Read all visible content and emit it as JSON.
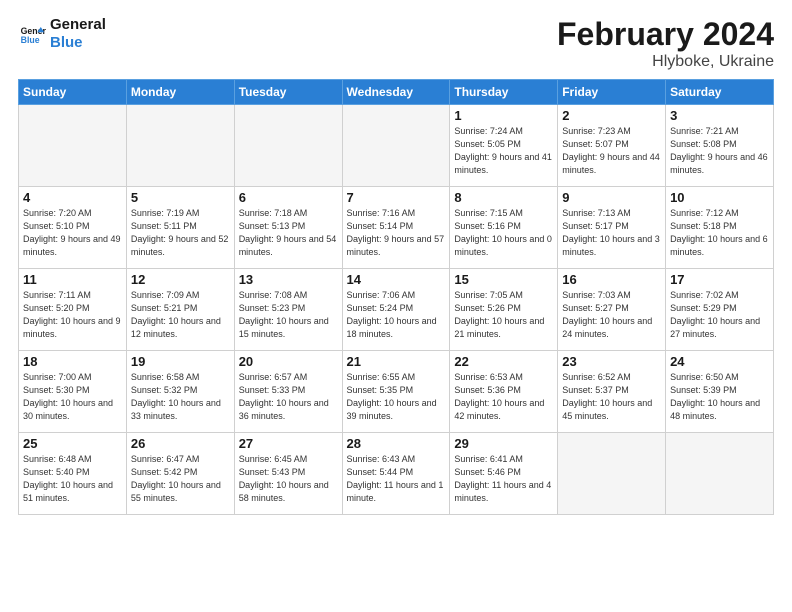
{
  "header": {
    "logo_line1": "General",
    "logo_line2": "Blue",
    "main_title": "February 2024",
    "sub_title": "Hlyboke, Ukraine"
  },
  "days_of_week": [
    "Sunday",
    "Monday",
    "Tuesday",
    "Wednesday",
    "Thursday",
    "Friday",
    "Saturday"
  ],
  "weeks": [
    [
      {
        "day": "",
        "info": ""
      },
      {
        "day": "",
        "info": ""
      },
      {
        "day": "",
        "info": ""
      },
      {
        "day": "",
        "info": ""
      },
      {
        "day": "1",
        "info": "Sunrise: 7:24 AM\nSunset: 5:05 PM\nDaylight: 9 hours\nand 41 minutes."
      },
      {
        "day": "2",
        "info": "Sunrise: 7:23 AM\nSunset: 5:07 PM\nDaylight: 9 hours\nand 44 minutes."
      },
      {
        "day": "3",
        "info": "Sunrise: 7:21 AM\nSunset: 5:08 PM\nDaylight: 9 hours\nand 46 minutes."
      }
    ],
    [
      {
        "day": "4",
        "info": "Sunrise: 7:20 AM\nSunset: 5:10 PM\nDaylight: 9 hours\nand 49 minutes."
      },
      {
        "day": "5",
        "info": "Sunrise: 7:19 AM\nSunset: 5:11 PM\nDaylight: 9 hours\nand 52 minutes."
      },
      {
        "day": "6",
        "info": "Sunrise: 7:18 AM\nSunset: 5:13 PM\nDaylight: 9 hours\nand 54 minutes."
      },
      {
        "day": "7",
        "info": "Sunrise: 7:16 AM\nSunset: 5:14 PM\nDaylight: 9 hours\nand 57 minutes."
      },
      {
        "day": "8",
        "info": "Sunrise: 7:15 AM\nSunset: 5:16 PM\nDaylight: 10 hours\nand 0 minutes."
      },
      {
        "day": "9",
        "info": "Sunrise: 7:13 AM\nSunset: 5:17 PM\nDaylight: 10 hours\nand 3 minutes."
      },
      {
        "day": "10",
        "info": "Sunrise: 7:12 AM\nSunset: 5:18 PM\nDaylight: 10 hours\nand 6 minutes."
      }
    ],
    [
      {
        "day": "11",
        "info": "Sunrise: 7:11 AM\nSunset: 5:20 PM\nDaylight: 10 hours\nand 9 minutes."
      },
      {
        "day": "12",
        "info": "Sunrise: 7:09 AM\nSunset: 5:21 PM\nDaylight: 10 hours\nand 12 minutes."
      },
      {
        "day": "13",
        "info": "Sunrise: 7:08 AM\nSunset: 5:23 PM\nDaylight: 10 hours\nand 15 minutes."
      },
      {
        "day": "14",
        "info": "Sunrise: 7:06 AM\nSunset: 5:24 PM\nDaylight: 10 hours\nand 18 minutes."
      },
      {
        "day": "15",
        "info": "Sunrise: 7:05 AM\nSunset: 5:26 PM\nDaylight: 10 hours\nand 21 minutes."
      },
      {
        "day": "16",
        "info": "Sunrise: 7:03 AM\nSunset: 5:27 PM\nDaylight: 10 hours\nand 24 minutes."
      },
      {
        "day": "17",
        "info": "Sunrise: 7:02 AM\nSunset: 5:29 PM\nDaylight: 10 hours\nand 27 minutes."
      }
    ],
    [
      {
        "day": "18",
        "info": "Sunrise: 7:00 AM\nSunset: 5:30 PM\nDaylight: 10 hours\nand 30 minutes."
      },
      {
        "day": "19",
        "info": "Sunrise: 6:58 AM\nSunset: 5:32 PM\nDaylight: 10 hours\nand 33 minutes."
      },
      {
        "day": "20",
        "info": "Sunrise: 6:57 AM\nSunset: 5:33 PM\nDaylight: 10 hours\nand 36 minutes."
      },
      {
        "day": "21",
        "info": "Sunrise: 6:55 AM\nSunset: 5:35 PM\nDaylight: 10 hours\nand 39 minutes."
      },
      {
        "day": "22",
        "info": "Sunrise: 6:53 AM\nSunset: 5:36 PM\nDaylight: 10 hours\nand 42 minutes."
      },
      {
        "day": "23",
        "info": "Sunrise: 6:52 AM\nSunset: 5:37 PM\nDaylight: 10 hours\nand 45 minutes."
      },
      {
        "day": "24",
        "info": "Sunrise: 6:50 AM\nSunset: 5:39 PM\nDaylight: 10 hours\nand 48 minutes."
      }
    ],
    [
      {
        "day": "25",
        "info": "Sunrise: 6:48 AM\nSunset: 5:40 PM\nDaylight: 10 hours\nand 51 minutes."
      },
      {
        "day": "26",
        "info": "Sunrise: 6:47 AM\nSunset: 5:42 PM\nDaylight: 10 hours\nand 55 minutes."
      },
      {
        "day": "27",
        "info": "Sunrise: 6:45 AM\nSunset: 5:43 PM\nDaylight: 10 hours\nand 58 minutes."
      },
      {
        "day": "28",
        "info": "Sunrise: 6:43 AM\nSunset: 5:44 PM\nDaylight: 11 hours\nand 1 minute."
      },
      {
        "day": "29",
        "info": "Sunrise: 6:41 AM\nSunset: 5:46 PM\nDaylight: 11 hours\nand 4 minutes."
      },
      {
        "day": "",
        "info": ""
      },
      {
        "day": "",
        "info": ""
      }
    ]
  ]
}
